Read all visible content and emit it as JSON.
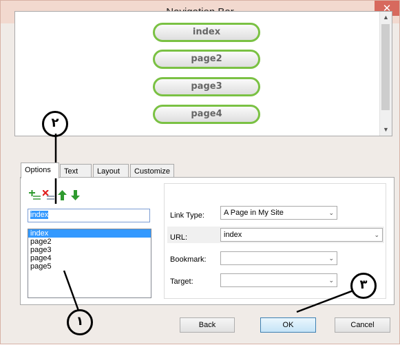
{
  "window": {
    "title": "Navigation Bar",
    "close_glyph": "✕"
  },
  "preview": {
    "buttons": [
      "index",
      "page2",
      "page3",
      "page4"
    ],
    "scroll_up": "▲",
    "scroll_down": "▼"
  },
  "tabs": [
    "Options",
    "Text",
    "Layout",
    "Customize"
  ],
  "toolbar": {
    "icons": [
      "add-page-icon",
      "remove-page-icon",
      "move-up-icon",
      "move-down-icon"
    ]
  },
  "name_input": {
    "value": "index"
  },
  "page_list": {
    "items": [
      "index",
      "page2",
      "page3",
      "page4",
      "page5"
    ],
    "selected": "index"
  },
  "properties": {
    "link_type_label": "Link Type:",
    "link_type_value": "A Page in My Site",
    "url_label": "URL:",
    "url_value": "index",
    "bookmark_label": "Bookmark:",
    "bookmark_value": "",
    "target_label": "Target:",
    "target_value": ""
  },
  "buttons": {
    "back": "Back",
    "ok": "OK",
    "cancel": "Cancel"
  },
  "callouts": [
    "٢",
    "١",
    "٣"
  ],
  "colors": {
    "nav_button_border": "#7ac143",
    "selection": "#3399ff",
    "close_button": "#d7695d"
  }
}
